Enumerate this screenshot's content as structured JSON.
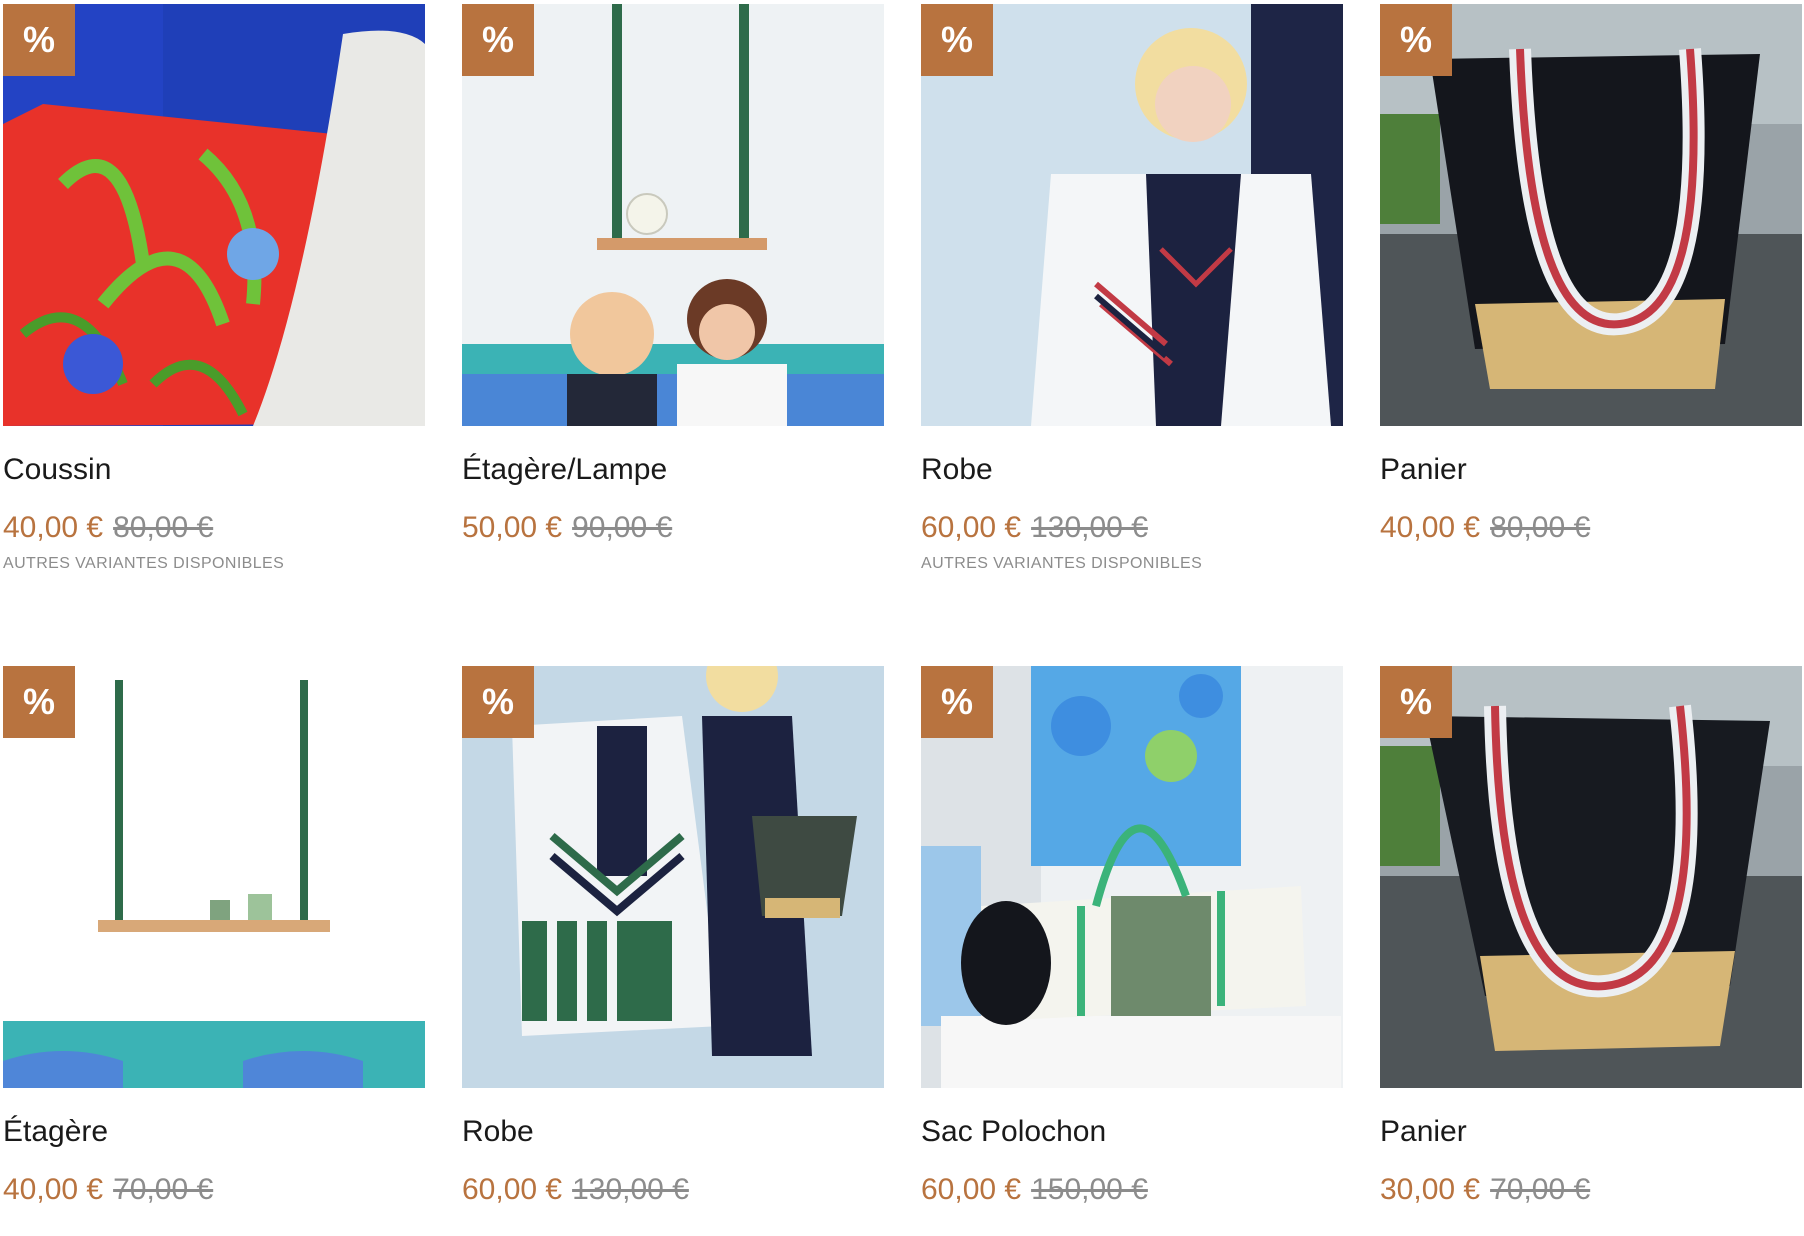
{
  "badge_symbol": "%",
  "colors": {
    "accent": "#b8733f",
    "muted": "#8c8c8c",
    "text": "#1a1a1a"
  },
  "products": [
    {
      "title": "Coussin",
      "price": "40,00 €",
      "old_price": "80,00 €",
      "variants": "AUTRES VARIANTES DISPONIBLES"
    },
    {
      "title": "Étagère/Lampe",
      "price": "50,00 €",
      "old_price": "90,00 €",
      "variants": ""
    },
    {
      "title": "Robe",
      "price": "60,00 €",
      "old_price": "130,00 €",
      "variants": "AUTRES VARIANTES DISPONIBLES"
    },
    {
      "title": "Panier",
      "price": "40,00 €",
      "old_price": "80,00 €",
      "variants": ""
    },
    {
      "title": "Étagère",
      "price": "40,00 €",
      "old_price": "70,00 €",
      "variants": ""
    },
    {
      "title": "Robe",
      "price": "60,00 €",
      "old_price": "130,00 €",
      "variants": ""
    },
    {
      "title": "Sac Polochon",
      "price": "60,00 €",
      "old_price": "150,00 €",
      "variants": ""
    },
    {
      "title": "Panier",
      "price": "30,00 €",
      "old_price": "70,00 €",
      "variants": ""
    }
  ]
}
